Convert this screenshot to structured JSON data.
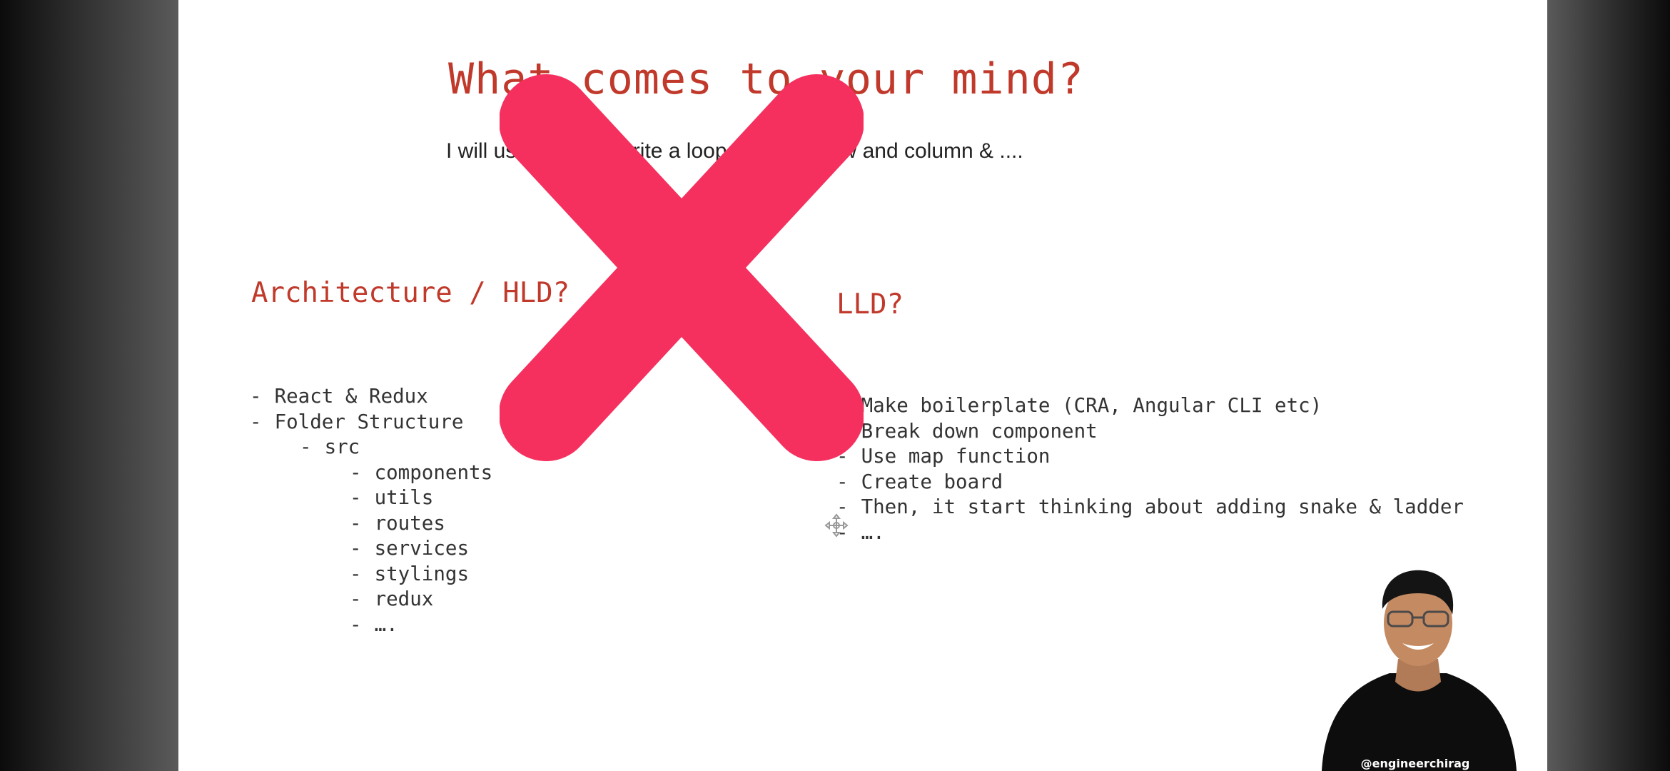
{
  "slide": {
    "title": "What comes to your mind?",
    "subtitle": "I will use grid and write a loop to create row and column & ....",
    "hld": {
      "heading": "Architecture / HLD?",
      "items": [
        {
          "text": "React & Redux",
          "level": 0
        },
        {
          "text": "Folder Structure",
          "level": 0
        },
        {
          "text": "src",
          "level": 1
        },
        {
          "text": "components",
          "level": 2
        },
        {
          "text": "utils",
          "level": 2
        },
        {
          "text": "routes",
          "level": 2
        },
        {
          "text": "services",
          "level": 2
        },
        {
          "text": "stylings",
          "level": 2
        },
        {
          "text": "redux",
          "level": 2
        },
        {
          "text": "….",
          "level": 2
        }
      ]
    },
    "lld": {
      "heading": "LLD?",
      "items": [
        "Make boilerplate (CRA, Angular CLI etc)",
        "Break down component",
        "Use map function",
        "Create board",
        "Then, it start thinking about adding snake & ladder",
        "…."
      ]
    },
    "overlay": {
      "symbol": "cross-mark",
      "color": "#f5305f"
    }
  },
  "presenter": {
    "handle": "@engineerchirag"
  },
  "colors": {
    "heading": "#c0392b",
    "cross": "#f5305f",
    "background": "#ffffff"
  }
}
